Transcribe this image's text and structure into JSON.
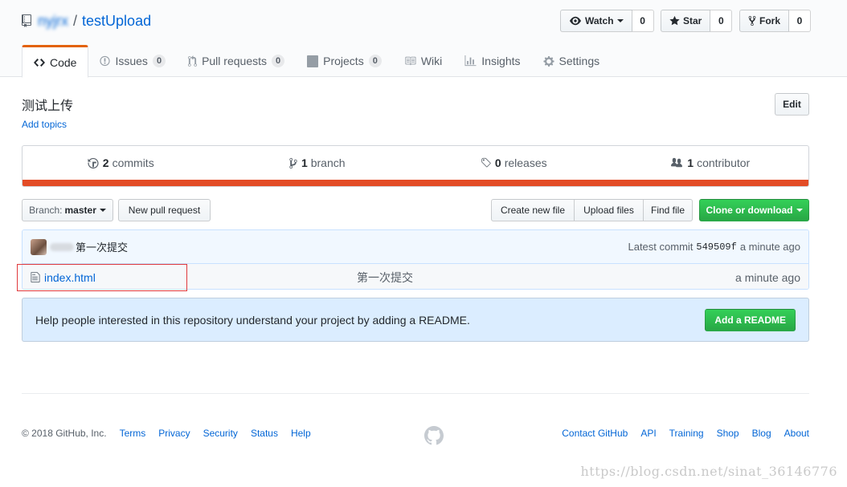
{
  "repo": {
    "owner": "nyjrx",
    "separator": "/",
    "name": "testUpload"
  },
  "actions": {
    "watch": {
      "label": "Watch",
      "count": "0"
    },
    "star": {
      "label": "Star",
      "count": "0"
    },
    "fork": {
      "label": "Fork",
      "count": "0"
    }
  },
  "tabs": [
    {
      "label": "Code",
      "icon": "code-icon",
      "selected": true
    },
    {
      "label": "Issues",
      "count": "0",
      "icon": "issue-icon"
    },
    {
      "label": "Pull requests",
      "count": "0",
      "icon": "pull-request-icon"
    },
    {
      "label": "Projects",
      "count": "0",
      "icon": "project-icon"
    },
    {
      "label": "Wiki",
      "icon": "book-icon"
    },
    {
      "label": "Insights",
      "icon": "graph-icon"
    },
    {
      "label": "Settings",
      "icon": "gear-icon"
    }
  ],
  "description": "测试上传",
  "add_topics": "Add topics",
  "edit_label": "Edit",
  "summary": {
    "commits": {
      "count": "2",
      "label": "commits"
    },
    "branches": {
      "count": "1",
      "label": "branch"
    },
    "releases": {
      "count": "0",
      "label": "releases"
    },
    "contributors": {
      "count": "1",
      "label": "contributor"
    },
    "language_color": "#e34c26"
  },
  "file_nav": {
    "branch_prefix": "Branch:",
    "branch_name": "master",
    "new_pull_request": "New pull request",
    "create_new_file": "Create new file",
    "upload_files": "Upload files",
    "find_file": "Find file",
    "clone_or_download": "Clone or download"
  },
  "commit": {
    "message": "第一次提交",
    "latest_label": "Latest commit",
    "sha": "549509f",
    "age": "a minute ago"
  },
  "files": [
    {
      "name": "index.html",
      "message": "第一次提交",
      "age": "a minute ago",
      "icon": "file-icon"
    }
  ],
  "readme_prompt": {
    "text": "Help people interested in this repository understand your project by adding a README.",
    "button": "Add a README"
  },
  "footer": {
    "copyright": "© 2018 GitHub, Inc.",
    "left_links": [
      "Terms",
      "Privacy",
      "Security",
      "Status",
      "Help"
    ],
    "right_links": [
      "Contact GitHub",
      "API",
      "Training",
      "Shop",
      "Blog",
      "About"
    ]
  },
  "watermark": "https://blog.csdn.net/sinat_36146776",
  "colors": {
    "link": "#0366d6",
    "selected_tab_border": "#e36209",
    "primary_button": "#28a745",
    "highlight_box": "#e0393c",
    "readme_prompt_bg": "#dbedff"
  }
}
